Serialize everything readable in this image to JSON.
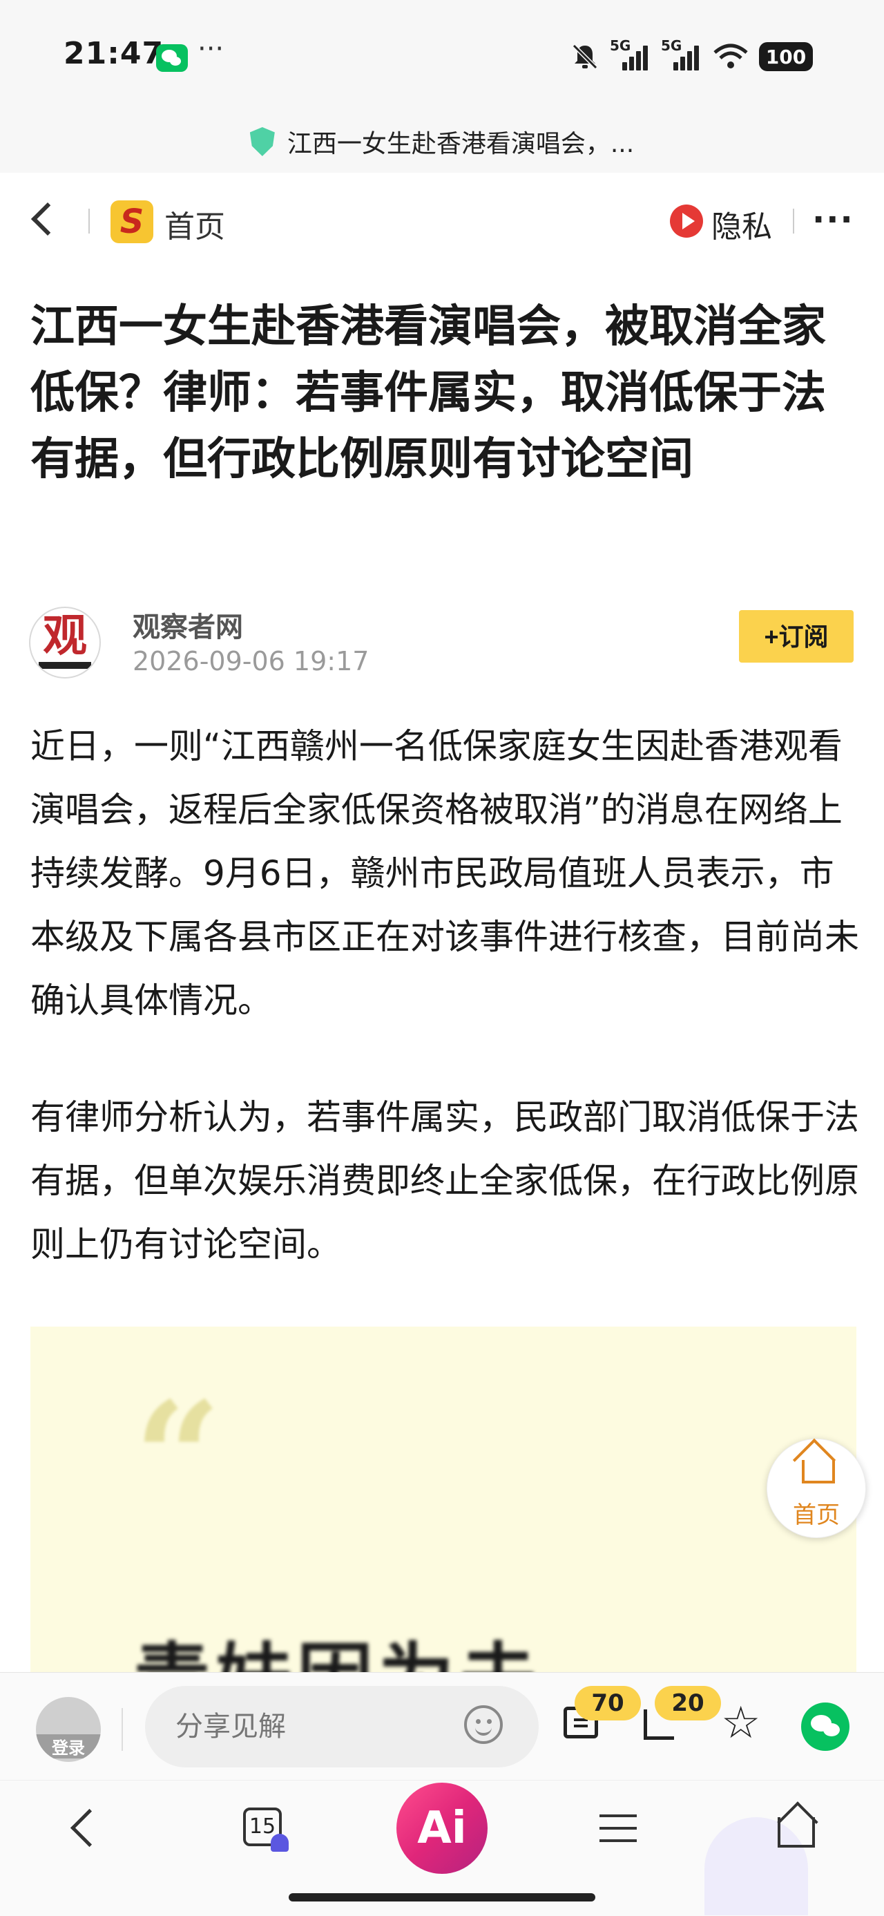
{
  "status_bar": {
    "time": "21:47",
    "more": "···",
    "signal_1": "5G",
    "signal_2": "5G",
    "battery": "100",
    "icons": [
      "wechat-icon",
      "mute-bell-icon",
      "signal-icon",
      "signal-icon",
      "wifi-icon",
      "battery-icon"
    ]
  },
  "url_bar": {
    "title": "江西一女生赴香港看演唱会，...",
    "icon": "shield-icon"
  },
  "top_nav": {
    "logo_letter": "S",
    "home_label": "首页",
    "privacy_label": "隐私",
    "more_label": "···"
  },
  "article": {
    "headline": "江西一女生赴香港看演唱会，被取消全家低保？律师：若事件属实，取消低保于法有据，但行政比例原则有讨论空间",
    "author": {
      "avatar_glyph": "观",
      "name": "观察者网",
      "time": "2026-09-06 19:17",
      "subscribe_label": "+订阅"
    },
    "paragraphs": [
      "近日，一则“江西赣州一名低保家庭女生因赴香港观看演唱会，返程后全家低保资格被取消”的消息在网络上持续发酵。9月6日，赣州市民政局值班人员表示，市本级及下属各县市区正在对该事件进行核查，目前尚未确认具体情况。",
      "有律师分析认为，若事件属实，民政部门取消低保于法有据，但单次娱乐消费即终止全家低保，在行政比例原则上仍有讨论空间。"
    ],
    "image": {
      "quote_mark": "“",
      "text": "青妹因为去"
    }
  },
  "floating_home": {
    "label": "首页"
  },
  "comment_bar": {
    "login_label": "登录",
    "input_placeholder": "分享见解",
    "comment_count": "70",
    "share_count": "20"
  },
  "browser_bar": {
    "tabs_count": "15",
    "ai_label": "Ai"
  },
  "colors": {
    "accent_yellow": "#fbd24d",
    "home_orange": "#e0861f",
    "wechat_green": "#07c160",
    "ai_pink": "#e0267a"
  }
}
